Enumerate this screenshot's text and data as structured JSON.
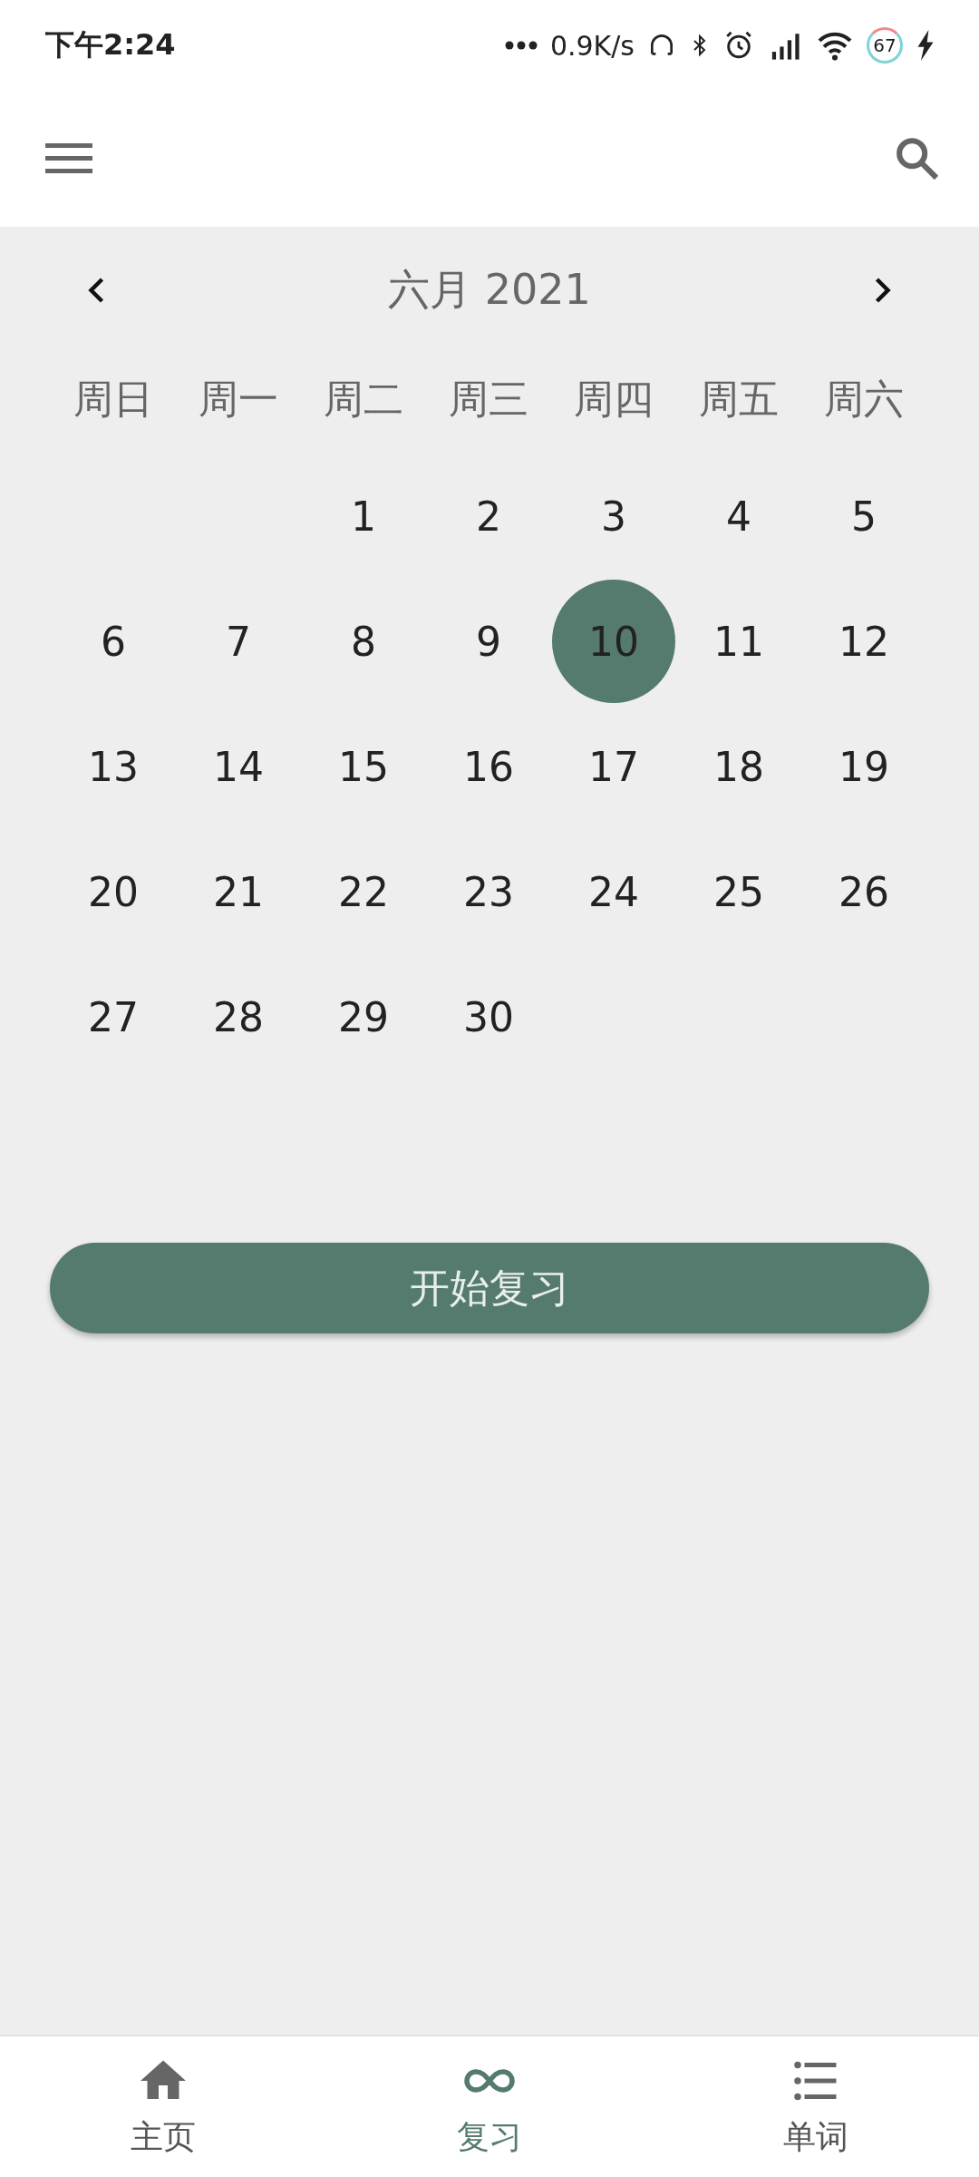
{
  "status_bar": {
    "time": "下午2:24",
    "net_speed": "0.9K/s",
    "battery": "67"
  },
  "calendar": {
    "month_title": "六月 2021",
    "weekdays": [
      "周日",
      "周一",
      "周二",
      "周三",
      "周四",
      "周五",
      "周六"
    ],
    "weeks": [
      [
        {
          "kind": "blank"
        },
        {
          "kind": "blank"
        },
        {
          "kind": "day",
          "label": "1",
          "selected": false
        },
        {
          "kind": "day",
          "label": "2",
          "selected": false
        },
        {
          "kind": "day",
          "label": "3",
          "selected": false
        },
        {
          "kind": "day",
          "label": "4",
          "selected": false
        },
        {
          "kind": "day",
          "label": "5",
          "selected": false
        }
      ],
      [
        {
          "kind": "day",
          "label": "6",
          "selected": false
        },
        {
          "kind": "day",
          "label": "7",
          "selected": false
        },
        {
          "kind": "day",
          "label": "8",
          "selected": false
        },
        {
          "kind": "day",
          "label": "9",
          "selected": false
        },
        {
          "kind": "day",
          "label": "10",
          "selected": true
        },
        {
          "kind": "day",
          "label": "11",
          "selected": false
        },
        {
          "kind": "day",
          "label": "12",
          "selected": false
        }
      ],
      [
        {
          "kind": "day",
          "label": "13",
          "selected": false
        },
        {
          "kind": "day",
          "label": "14",
          "selected": false
        },
        {
          "kind": "day",
          "label": "15",
          "selected": false
        },
        {
          "kind": "day",
          "label": "16",
          "selected": false
        },
        {
          "kind": "day",
          "label": "17",
          "selected": false
        },
        {
          "kind": "day",
          "label": "18",
          "selected": false
        },
        {
          "kind": "day",
          "label": "19",
          "selected": false
        }
      ],
      [
        {
          "kind": "day",
          "label": "20",
          "selected": false
        },
        {
          "kind": "day",
          "label": "21",
          "selected": false
        },
        {
          "kind": "day",
          "label": "22",
          "selected": false
        },
        {
          "kind": "day",
          "label": "23",
          "selected": false
        },
        {
          "kind": "day",
          "label": "24",
          "selected": false
        },
        {
          "kind": "day",
          "label": "25",
          "selected": false
        },
        {
          "kind": "day",
          "label": "26",
          "selected": false
        }
      ],
      [
        {
          "kind": "day",
          "label": "27",
          "selected": false
        },
        {
          "kind": "day",
          "label": "28",
          "selected": false
        },
        {
          "kind": "day",
          "label": "29",
          "selected": false
        },
        {
          "kind": "day",
          "label": "30",
          "selected": false
        },
        {
          "kind": "blank"
        },
        {
          "kind": "blank"
        },
        {
          "kind": "blank"
        }
      ]
    ]
  },
  "start_button": "开始复习",
  "bottom_nav": [
    {
      "kind": "home",
      "label": "主页",
      "selected": false
    },
    {
      "kind": "review",
      "label": "复习",
      "selected": true
    },
    {
      "kind": "list",
      "label": "单词",
      "selected": false
    }
  ]
}
